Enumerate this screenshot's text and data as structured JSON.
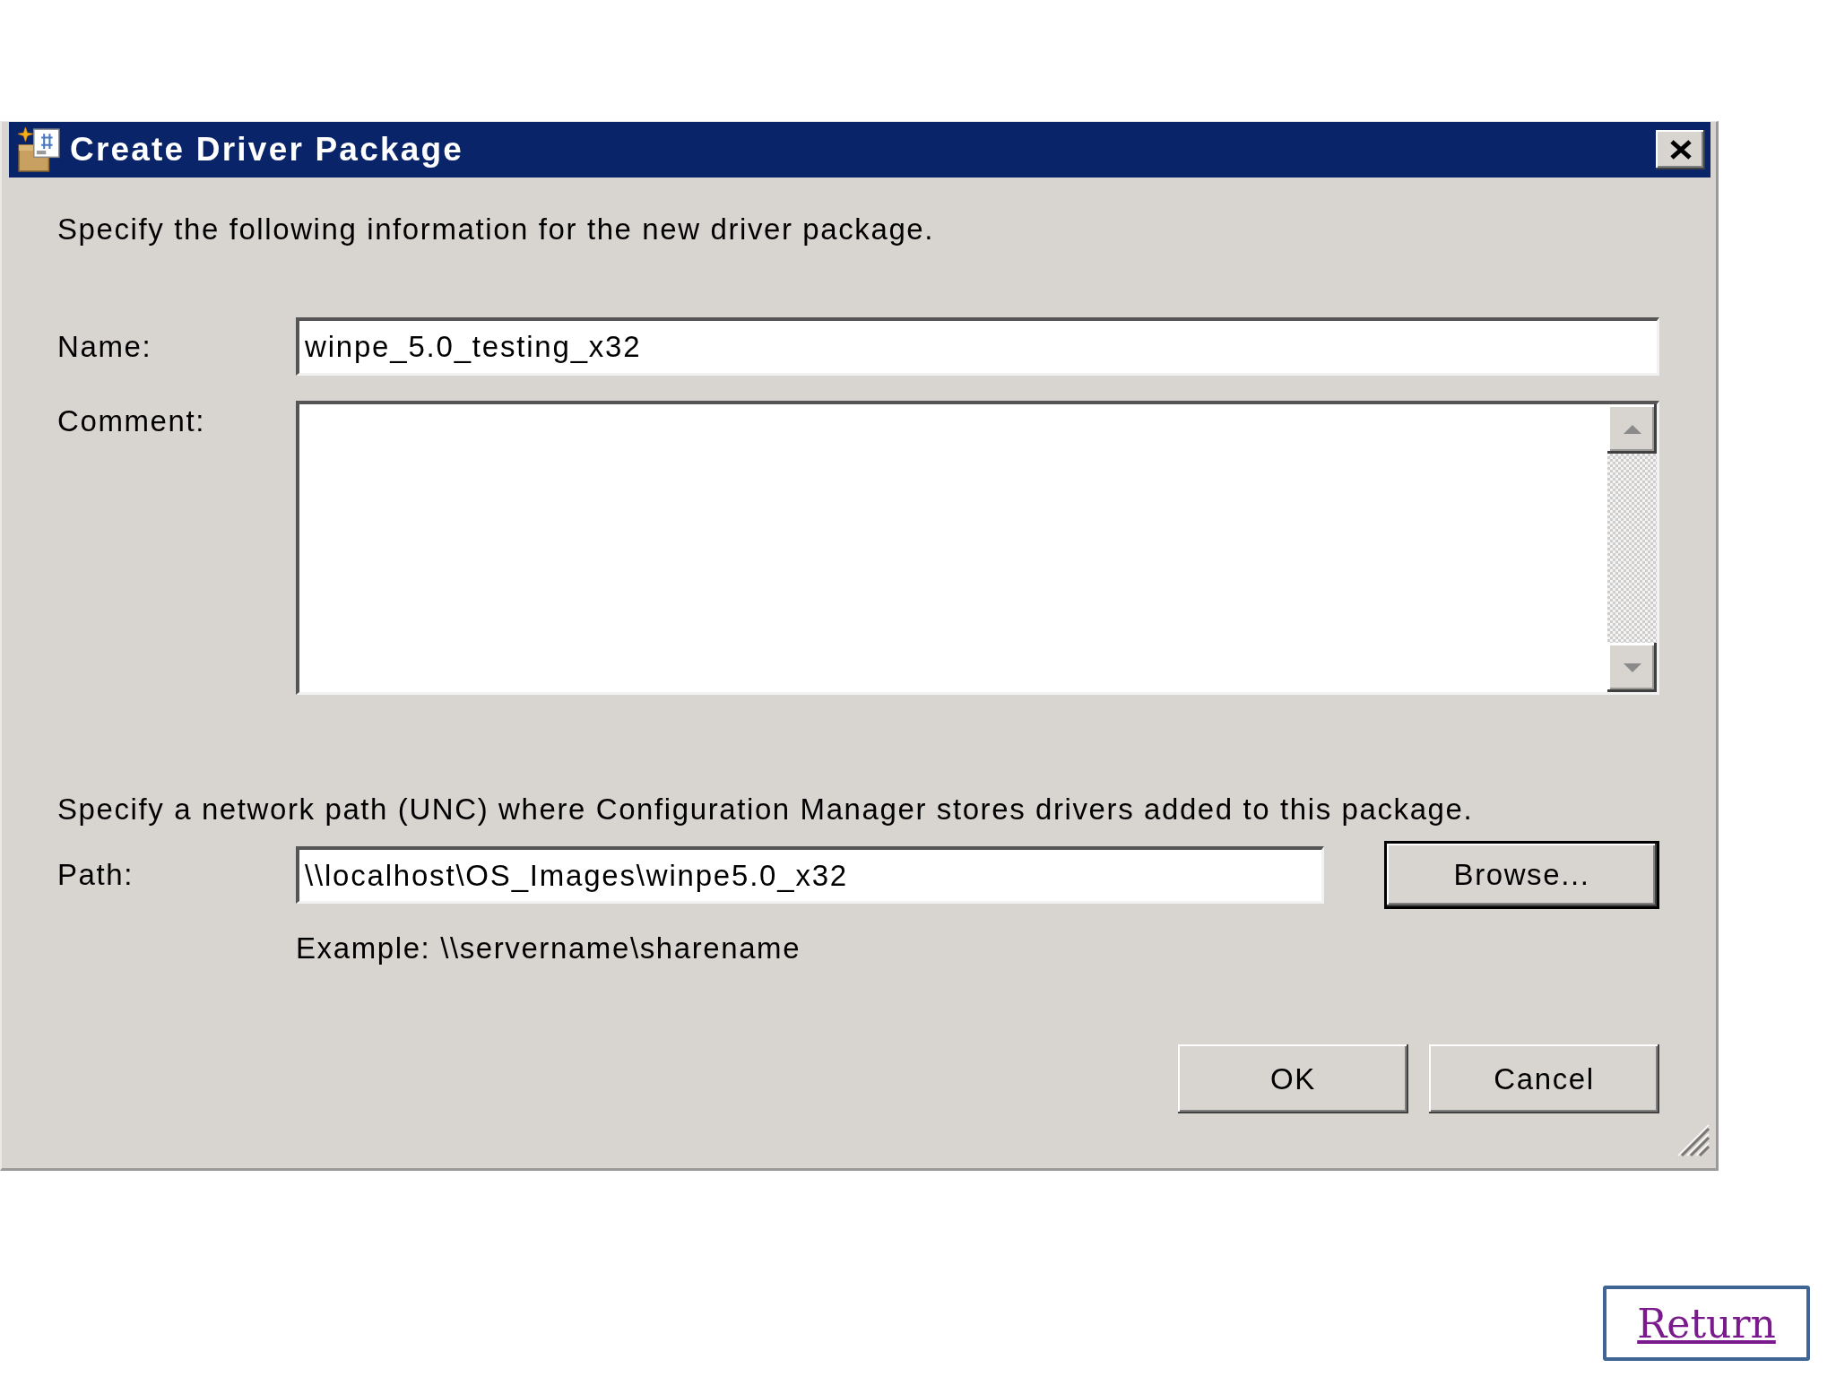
{
  "window": {
    "title": "Create Driver Package"
  },
  "intro": "Specify the following information for the new driver package.",
  "fields": [
    {
      "kind": "text",
      "label": "Name:",
      "value": "winpe_5.0_testing_x32"
    },
    {
      "kind": "textarea",
      "label": "Comment:"
    }
  ],
  "path_section": {
    "instruction": "Specify a network path (UNC) where Configuration Manager stores drivers added to this package.",
    "label": "Path:",
    "value": "\\\\localhost\\OS_Images\\winpe5.0_x32",
    "browse": {
      "label": "Browse...",
      "default": true
    },
    "example": "Example: \\\\servername\\sharename"
  },
  "buttons": [
    {
      "label": "OK",
      "default": false
    },
    {
      "label": "Cancel",
      "default": false
    }
  ],
  "return_link": "Return"
}
